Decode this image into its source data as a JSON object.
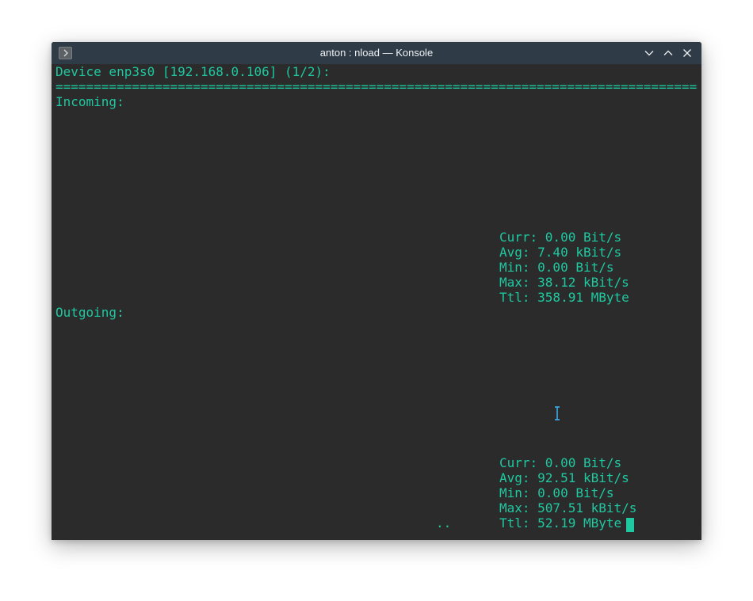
{
  "window": {
    "title": "anton : nload — Konsole"
  },
  "icons": {
    "app": "konsole-prompt-icon",
    "minimize": "chevron-down-icon",
    "maximize": "chevron-up-icon",
    "close": "close-icon",
    "pointer": "text-cursor-ibeam-icon"
  },
  "colors": {
    "titlebar": "#2f3b47",
    "terminal_bg": "#2b2b2b",
    "terminal_fg": "#1ec8a0",
    "ibeam": "#3daee9"
  },
  "terminal": {
    "header": "Device enp3s0 [192.168.0.106] (1/2):",
    "separator": "================================================================================================",
    "incoming": {
      "label": "Incoming:",
      "curr": "Curr: 0.00 Bit/s",
      "avg": "Avg: 7.40 kBit/s",
      "min": "Min: 0.00 Bit/s",
      "max": "Max: 38.12 kBit/s",
      "ttl": "Ttl: 358.91 MByte"
    },
    "outgoing": {
      "label": "Outgoing:",
      "curr": "Curr: 0.00 Bit/s",
      "avg": "Avg: 92.51 kBit/s",
      "min": "Min: 0.00 Bit/s",
      "max": "Max: 507.51 kBit/s",
      "ttl": "Ttl: 52.19 MByte"
    },
    "graph_marks": ".."
  }
}
